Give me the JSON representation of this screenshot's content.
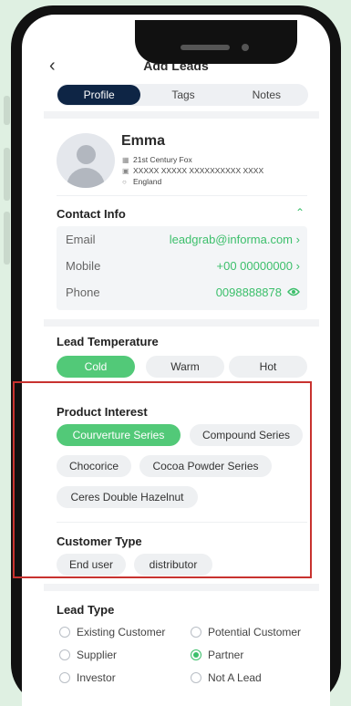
{
  "header": {
    "back_icon": "chevron-left-icon",
    "title": "Add Leads"
  },
  "tabs": [
    {
      "label": "Profile",
      "active": true
    },
    {
      "label": "Tags",
      "active": false
    },
    {
      "label": "Notes",
      "active": false
    }
  ],
  "profile": {
    "name": "Emma",
    "company": "21st Century Fox",
    "address": "XXXXX XXXXX XXXXXXXXXX XXXX",
    "country": "England"
  },
  "contact": {
    "title": "Contact Info",
    "rows": [
      {
        "label": "Email",
        "value": "leadgrab@informa.com",
        "icon": "chevron-right-icon"
      },
      {
        "label": "Mobile",
        "value": "+00 00000000",
        "icon": "chevron-right-icon"
      },
      {
        "label": "Phone",
        "value": "0098888878",
        "icon": "eye-icon"
      }
    ]
  },
  "temperature": {
    "title": "Lead Temperature",
    "options": [
      {
        "label": "Cold",
        "selected": true
      },
      {
        "label": "Warm",
        "selected": false
      },
      {
        "label": "Hot",
        "selected": false
      }
    ]
  },
  "product_interest": {
    "title": "Product Interest",
    "items": [
      {
        "label": "Courverture Series",
        "selected": true
      },
      {
        "label": "Compound Series",
        "selected": false
      },
      {
        "label": "Chocorice",
        "selected": false
      },
      {
        "label": "Cocoa Powder Series",
        "selected": false
      },
      {
        "label": "Ceres Double Hazelnut",
        "selected": false
      }
    ]
  },
  "customer_type": {
    "title": "Customer Type",
    "items": [
      {
        "label": "End user",
        "selected": false
      },
      {
        "label": "distributor",
        "selected": false
      }
    ]
  },
  "lead_type": {
    "title": "Lead Type",
    "options": [
      {
        "label": "Existing Customer",
        "selected": false
      },
      {
        "label": "Potential Customer",
        "selected": false
      },
      {
        "label": "Supplier",
        "selected": false
      },
      {
        "label": "Partner",
        "selected": true
      },
      {
        "label": "Investor",
        "selected": false
      },
      {
        "label": "Not A Lead",
        "selected": false
      }
    ]
  },
  "colors": {
    "accent": "#52c978",
    "tab_active": "#0e2545",
    "highlight_border": "#c8322f"
  }
}
